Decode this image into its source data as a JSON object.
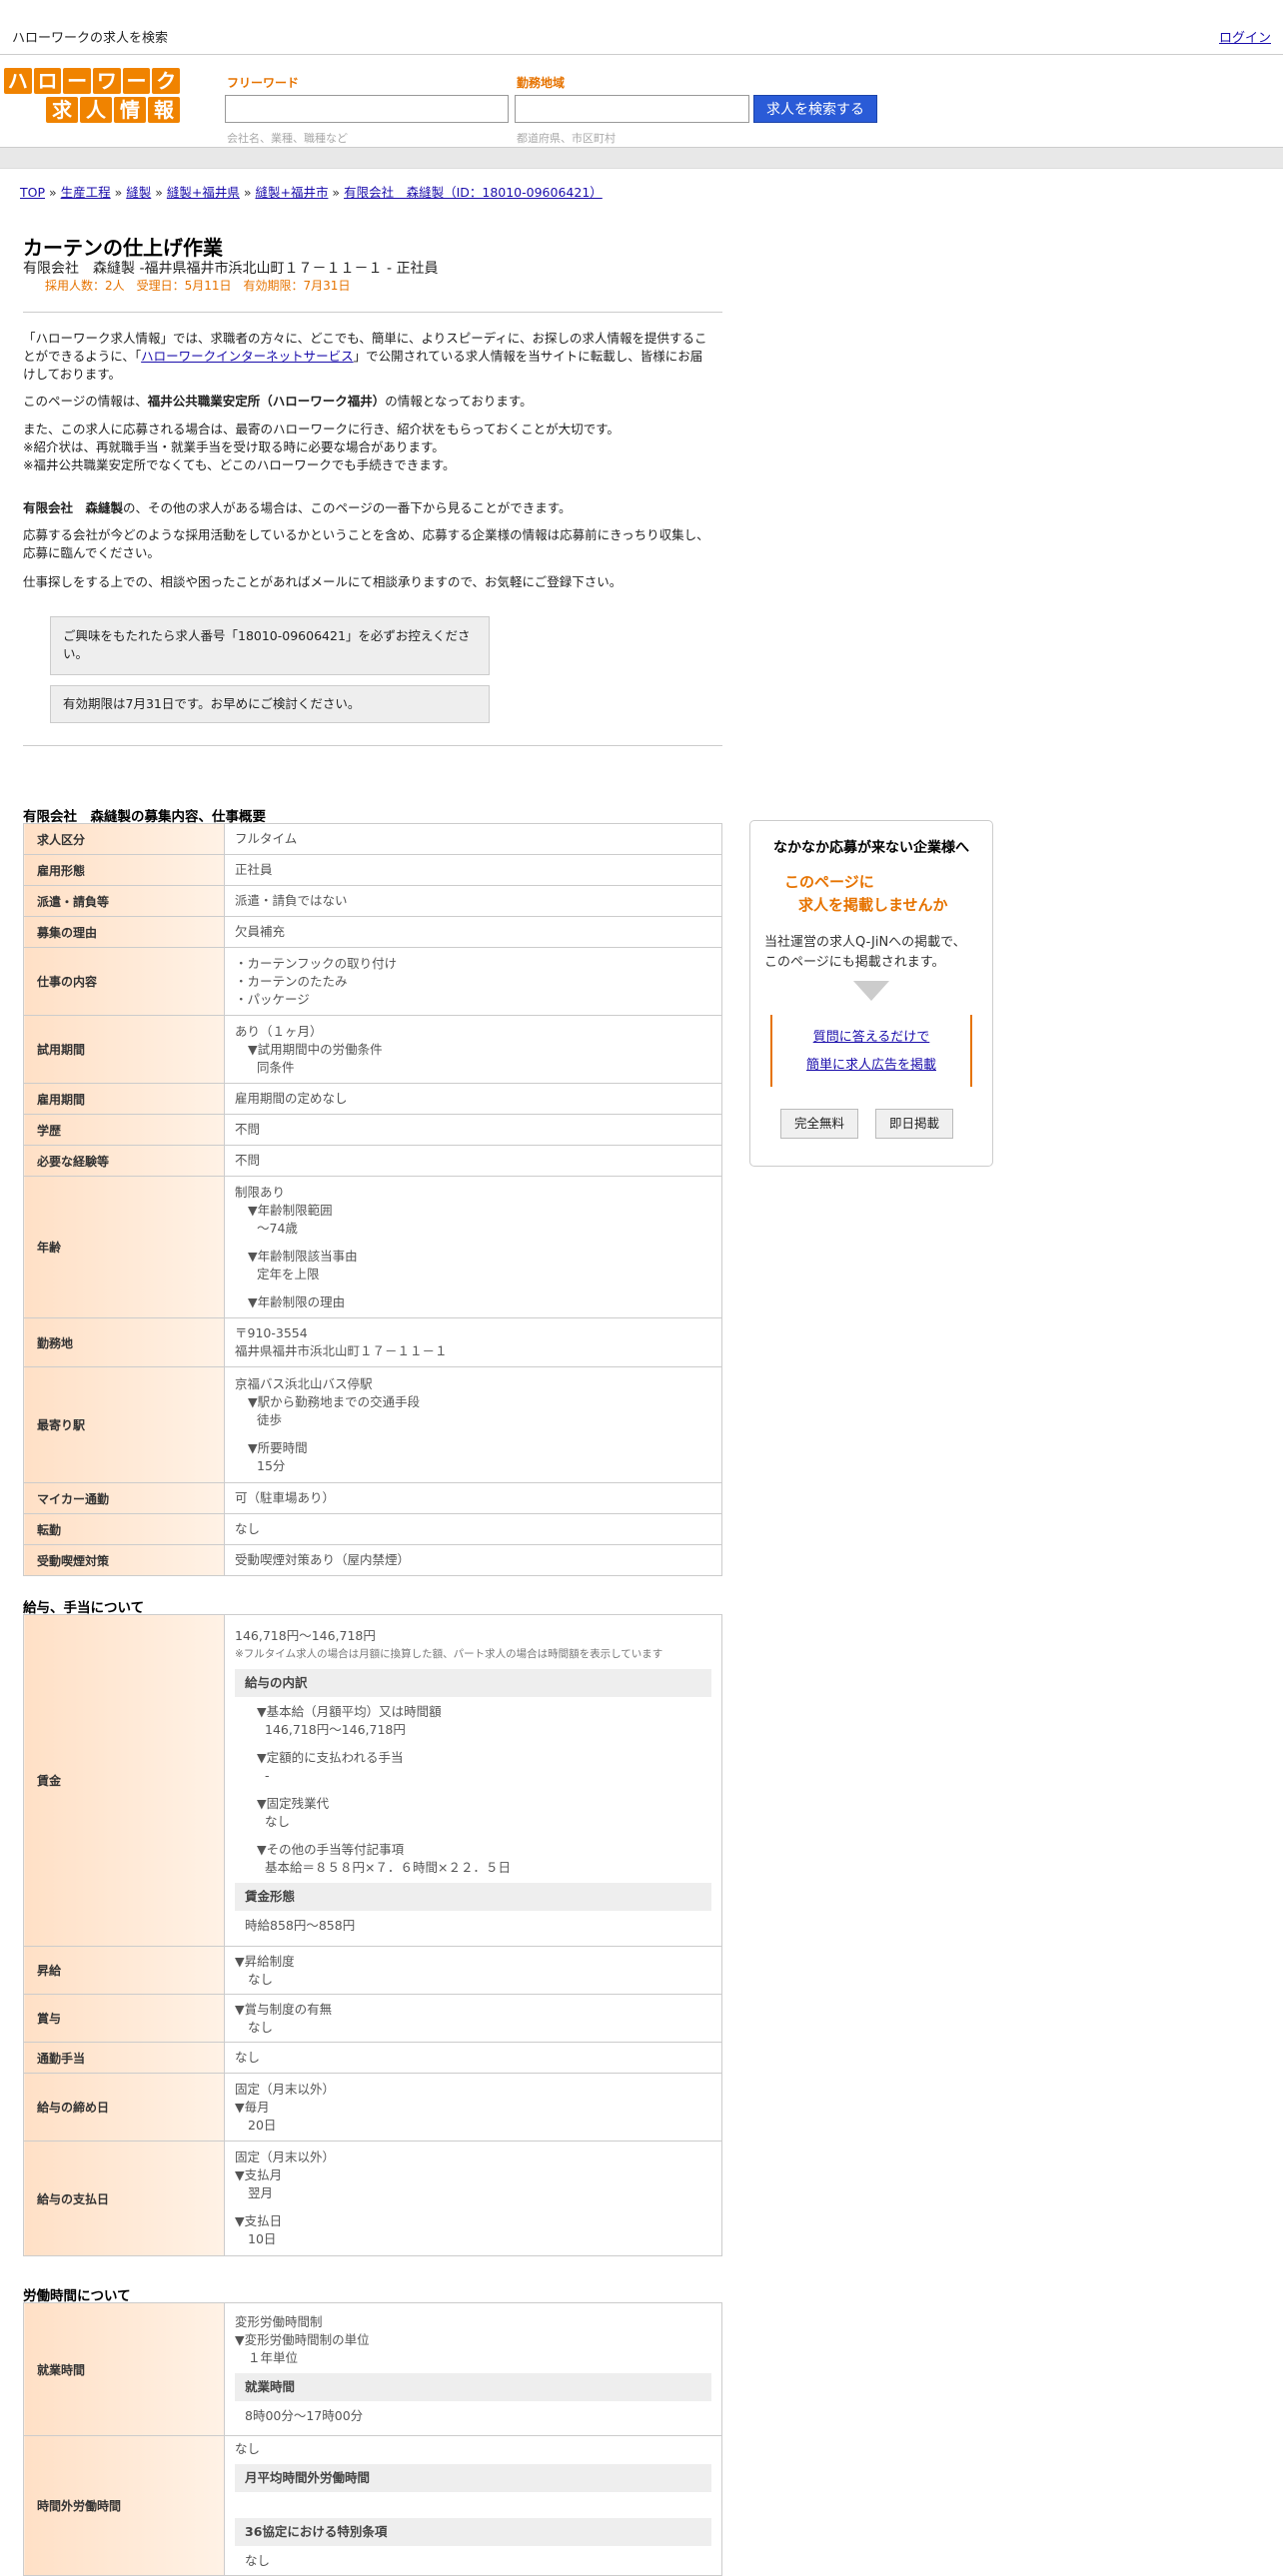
{
  "top": {
    "site": "ハローワークの求人を検索",
    "login": "ログイン"
  },
  "logo": {
    "row1": [
      "ハ",
      "ロ",
      "ー",
      "ワ",
      "ー",
      "ク"
    ],
    "row2": [
      "求",
      "人",
      "情",
      "報"
    ]
  },
  "search": {
    "keyword_label": "フリーワード",
    "keyword_placeholder": "会社名、業種、職種など",
    "area_label": "勤務地域",
    "area_placeholder": "都道府県、市区町村",
    "button": "求人を検索する"
  },
  "breadcrumb": [
    "TOP",
    "生産工程",
    "縫製",
    "縫製+福井県",
    "縫製+福井市",
    "有限会社　森縫製（ID：18010-09606421）"
  ],
  "job": {
    "title": "カーテンの仕上げ作業",
    "subtitle": "有限会社　森縫製 -福井県福井市浜北山町１７－１１－１ - 正社員",
    "meta": "採用人数：2人　受理日：5月11日　有効期限：7月31日"
  },
  "intro": {
    "p1a": "「ハローワーク求人情報」では、求職者の方々に、どこでも、簡単に、よりスピーディに、お探しの求人情報を提供することができるように、「",
    "p1link": "ハローワークインターネットサービス",
    "p1b": "」で公開されている求人情報を当サイトに転載し、皆様にお届けしております。",
    "p2a": "このページの情報は、",
    "p2b": "福井公共職業安定所（ハローワーク福井）",
    "p2c": "の情報となっております。",
    "p3": "また、この求人に応募される場合は、最寄のハローワークに行き、紹介状をもらっておくことが大切です。",
    "p3b": "※紹介状は、再就職手当・就業手当を受け取る時に必要な場合があります。",
    "p3c": "※福井公共職業安定所でなくても、どこのハローワークでも手続きできます。",
    "p4a": "有限会社　森縫製",
    "p4b": "の、その他の求人がある場合は、このページの一番下から見ることができます。",
    "p5": "応募する会社が今どのような採用活動をしているかということを含め、応募する企業様の情報は応募前にきっちり収集し、応募に臨んでください。",
    "p6": "仕事探しをする上での、相談や困ったことがあればメールにて相談承りますので、お気軽にご登録下さい。",
    "n1": "ご興味をもたれたら求人番号「18010-09606421」を必ずお控えください。",
    "n2": "有効期限は7月31日です。お早めにご検討ください。"
  },
  "sections": {
    "s1": "有限会社　森縫製の募集内容、仕事概要",
    "s2": "給与、手当について",
    "s3": "労働時間について"
  },
  "t1": {
    "r1": [
      "求人区分",
      "フルタイム"
    ],
    "r2": [
      "雇用形態",
      "正社員"
    ],
    "r3": [
      "派遣・請負等",
      "派遣・請負ではない"
    ],
    "r4": [
      "募集の理由",
      "欠員補充"
    ],
    "r5": [
      "仕事の内容",
      "・カーテンフックの取り付け",
      "・カーテンのたたみ",
      "・パッケージ"
    ],
    "r6": [
      "試用期間",
      "あり（１ヶ月）",
      "▼試用期間中の労働条件",
      "同条件"
    ],
    "r7": [
      "雇用期間",
      "雇用期間の定めなし"
    ],
    "r8": [
      "学歴",
      "不問"
    ],
    "r9": [
      "必要な経験等",
      "不問"
    ],
    "r10": [
      "年齢",
      "制限あり",
      "▼年齢制限範囲",
      "〜74歳",
      "▼年齢制限該当事由",
      "定年を上限",
      "▼年齢制限の理由"
    ],
    "r11": [
      "勤務地",
      "〒910-3554",
      "福井県福井市浜北山町１７－１１－１"
    ],
    "r12": [
      "最寄り駅",
      "京福バス浜北山バス停駅",
      "▼駅から勤務地までの交通手段",
      "徒歩",
      "▼所要時間",
      "15分"
    ],
    "r13": [
      "マイカー通勤",
      "可（駐車場あり）"
    ],
    "r14": [
      "転勤",
      "なし"
    ],
    "r15": [
      "受動喫煙対策",
      "受動喫煙対策あり（屋内禁煙）"
    ]
  },
  "t2": {
    "wage": [
      "賃金",
      "146,718円〜146,718円",
      "※フルタイム求人の場合は月額に換算した額、パート求人の場合は時間額を表示しています",
      "給与の内訳",
      "▼基本給（月額平均）又は時間額",
      "146,718円〜146,718円",
      "▼定額的に支払われる手当",
      "-",
      "▼固定残業代",
      "なし",
      "▼その他の手当等付記事項",
      "基本給＝８５８円×７．６時間×２２．５日",
      "賃金形態",
      "時給858円〜858円"
    ],
    "raise": [
      "昇給",
      "▼昇給制度",
      "なし"
    ],
    "bonus": [
      "賞与",
      "▼賞与制度の有無",
      "なし"
    ],
    "commute": [
      "通勤手当",
      "なし"
    ],
    "close": [
      "給与の締め日",
      "固定（月末以外）",
      "▼毎月",
      "20日"
    ],
    "pay": [
      "給与の支払日",
      "固定（月末以外）",
      "▼支払月",
      "翌月",
      "▼支払日",
      "10日"
    ]
  },
  "t3": {
    "hours": [
      "就業時間",
      "変形労働時間制",
      "▼変形労働時間制の単位",
      "１年単位",
      "就業時間",
      "8時00分〜17時00分"
    ],
    "overtime": [
      "時間外労働時間",
      "なし",
      "月平均時間外労働時間",
      "36協定における特別条項",
      "なし"
    ]
  },
  "side": {
    "t1": "なかなか応募が来ない企業様へ",
    "t2a": "このページに",
    "t2b": "求人を掲載しませんか",
    "t3a": "当社運営の求人Q-JiNへの掲載で、",
    "t3b": "このページにも掲載されます。",
    "link1": "質問に答えるだけで",
    "link2": "簡単に求人広告を掲載",
    "btn1": "完全無料",
    "btn2": "即日掲載"
  }
}
